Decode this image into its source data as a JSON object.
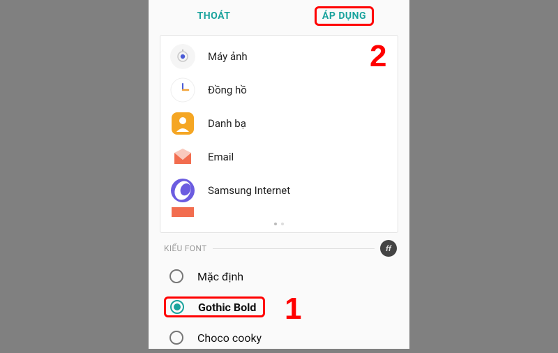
{
  "header": {
    "exit": "THOÁT",
    "apply": "ÁP DỤNG"
  },
  "apps": [
    {
      "label": "Máy ảnh"
    },
    {
      "label": "Đồng hồ"
    },
    {
      "label": "Danh bạ"
    },
    {
      "label": "Email"
    },
    {
      "label": "Samsung Internet"
    }
  ],
  "section_title": "KIỂU FONT",
  "ff_badge": "ff",
  "fonts": [
    {
      "label": "Mặc định",
      "selected": false
    },
    {
      "label": "Gothic Bold",
      "selected": true
    },
    {
      "label": "Choco cooky",
      "selected": false
    }
  ],
  "callouts": {
    "one": "1",
    "two": "2"
  }
}
